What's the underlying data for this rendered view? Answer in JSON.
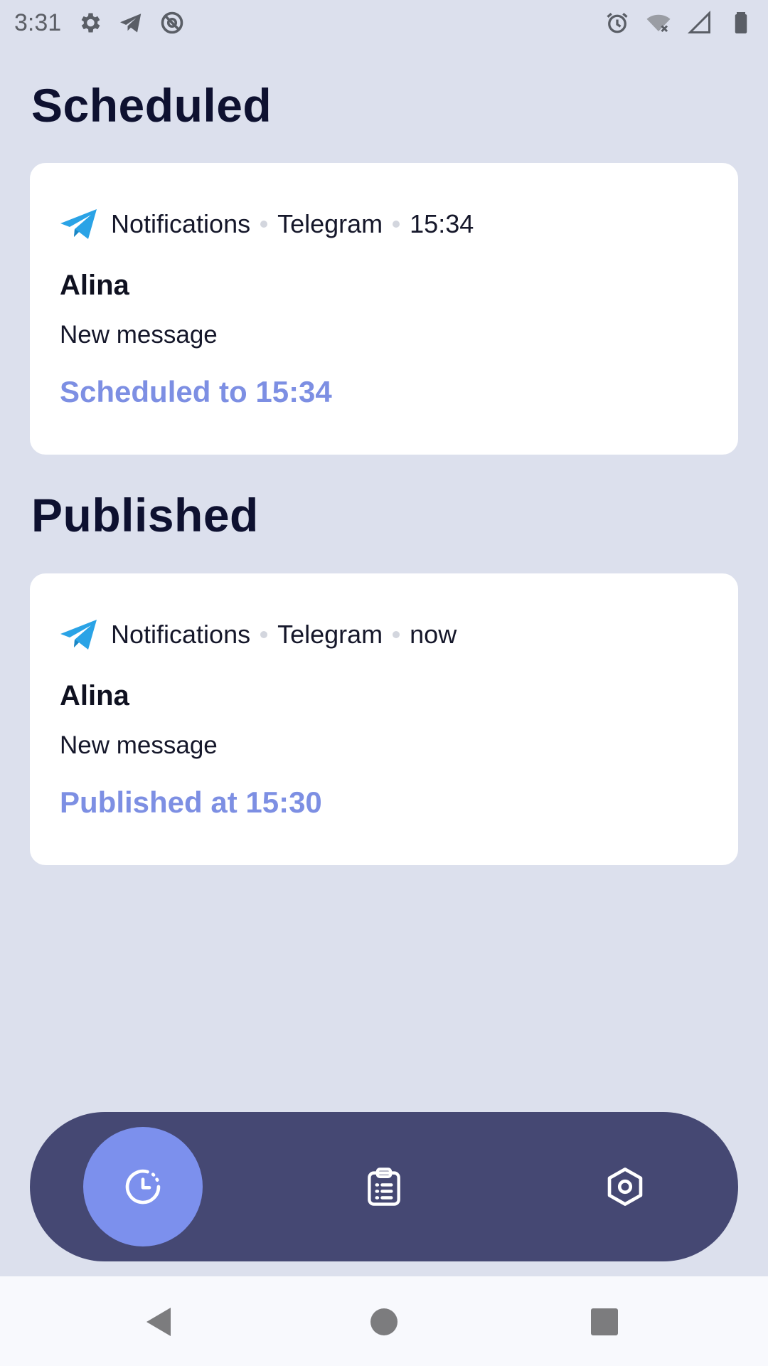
{
  "status_bar": {
    "time": "3:31",
    "left_icons": [
      "gear-icon",
      "telegram-icon",
      "at-sign-icon"
    ],
    "right_icons": [
      "alarm-icon",
      "wifi-off-icon",
      "signal-icon",
      "battery-icon"
    ]
  },
  "sections": {
    "scheduled": {
      "title": "Scheduled",
      "card": {
        "app_icon": "telegram-icon",
        "channel": "Notifications",
        "app": "Telegram",
        "time": "15:34",
        "sender": "Alina",
        "message": "New message",
        "status": "Scheduled to 15:34"
      }
    },
    "published": {
      "title": "Published",
      "card": {
        "app_icon": "telegram-icon",
        "channel": "Notifications",
        "app": "Telegram",
        "time": "now",
        "sender": "Alina",
        "message": "New message",
        "status": "Published at 15:30"
      }
    }
  },
  "bottom_nav": {
    "items": [
      {
        "icon": "clock-icon",
        "active": true
      },
      {
        "icon": "clipboard-list-icon",
        "active": false
      },
      {
        "icon": "settings-hex-icon",
        "active": false
      }
    ]
  },
  "system_nav": [
    "back-icon",
    "home-icon",
    "recents-icon"
  ],
  "colors": {
    "background": "#dce0ed",
    "card": "#ffffff",
    "accent": "#7d8fe3",
    "nav_bar": "#454873",
    "nav_active": "#7c90ed",
    "telegram_blue": "#2aa3e6"
  }
}
